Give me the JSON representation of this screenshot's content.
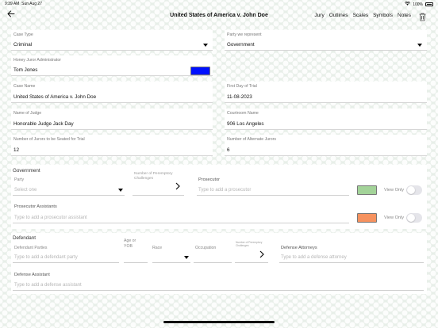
{
  "status": {
    "time": "9:39 AM",
    "date": "Sun Aug 27",
    "battery": "100%"
  },
  "nav": {
    "title": "United States of America v. John Doe",
    "links": [
      "Jury",
      "Outlines",
      "Scales",
      "Symbols",
      "Notes"
    ]
  },
  "fields": {
    "case_type": {
      "label": "Case Type",
      "value": "Criminal"
    },
    "party": {
      "label": "Party we represent",
      "value": "Government"
    },
    "honey": {
      "label": "Honey Juror Administrator",
      "value": "Tom Jones"
    },
    "case_name": {
      "label": "Case Name",
      "value": "United States of America v. John Doe"
    },
    "first_day": {
      "label": "First Day of Trial",
      "value": "11-08-2023"
    },
    "judge": {
      "label": "Name of Judge",
      "value": "Honorable Judge Jack Day"
    },
    "courtroom": {
      "label": "Courtroom Name",
      "value": "906 Los Angeles"
    },
    "jurors": {
      "label": "Number of Jurors to be Seated for Trial",
      "value": "12"
    },
    "alternates": {
      "label": "Number of Alternate Jurors",
      "value": "6"
    }
  },
  "government": {
    "title": "Government",
    "party_label": "Party",
    "party_placeholder": "Select one",
    "peremptory_label": "Number of Peremptory Challenges",
    "prosecutor_label": "Prosecutor",
    "prosecutor_placeholder": "Type to add a prosecutor",
    "view_only": "View Only",
    "assistants_label": "Prosecutor Assistants",
    "assistants_placeholder": "Type to add a prosecutor assistant"
  },
  "defendant": {
    "title": "Defendant",
    "parties_label": "Defendant Parties",
    "parties_placeholder": "Type to add a defendant party",
    "age_label": "Age or YOB",
    "race_label": "Race",
    "occupation_label": "Occupation",
    "peremptory_label": "Number of Peremptory Challenges",
    "attorneys_label": "Defense Attorneys",
    "attorneys_placeholder": "Type to add a defense attorney",
    "assistant_label": "Defense Assistant",
    "assistant_placeholder": "Type to add a defense assistant"
  },
  "colors": {
    "honey_swatch": "#0010ff",
    "prosecutor_swatch": "#a3d399",
    "assistant_swatch": "#f6925f"
  },
  "icons": {
    "back": "arrow-left-icon",
    "trash": "trash-icon",
    "dropdown": "triangle-down-icon",
    "chevron": "chevron-right-icon"
  }
}
